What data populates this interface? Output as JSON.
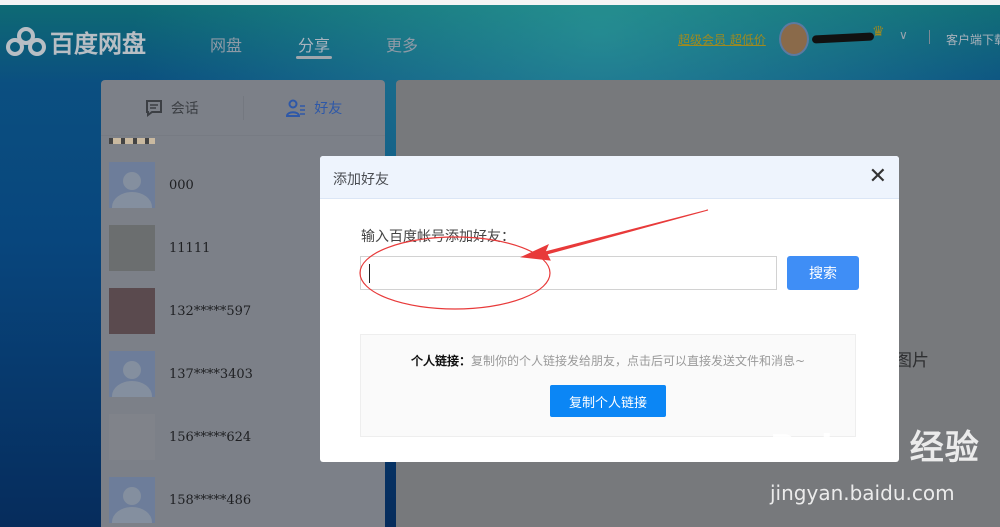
{
  "header": {
    "logo": "百度网盘",
    "nav": [
      "网盘",
      "分享",
      "更多"
    ],
    "active_nav": "分享",
    "vip_link": "超级会员 超低价",
    "client_download": "客户端下载"
  },
  "sidebar": {
    "tabs": [
      {
        "label": "会话",
        "icon": "chat-icon"
      },
      {
        "label": "好友",
        "icon": "friends-icon"
      }
    ],
    "active_tab": "好友",
    "friends": [
      {
        "name": "000"
      },
      {
        "name": "11111"
      },
      {
        "name": "132*****597"
      },
      {
        "name": "137****3403"
      },
      {
        "name": "156*****624"
      },
      {
        "name": "158*****486"
      }
    ]
  },
  "right_panel": {
    "partial_text": "图片"
  },
  "dialog": {
    "title": "添加好友",
    "close": "✕",
    "input_label": "输入百度帐号添加好友：",
    "input_value": "",
    "search_button": "搜索",
    "link_label": "个人链接：",
    "link_desc": "复制你的个人链接发给朋友，点击后可以直接发送文件和消息~",
    "copy_button": "复制个人链接"
  },
  "watermark": {
    "brand": "Bai du 经验",
    "url": "jingyan.baidu.com"
  },
  "colors": {
    "primary": "#3f8ef6",
    "copy_button": "#0b86f5",
    "annotation": "#e83a3a"
  }
}
